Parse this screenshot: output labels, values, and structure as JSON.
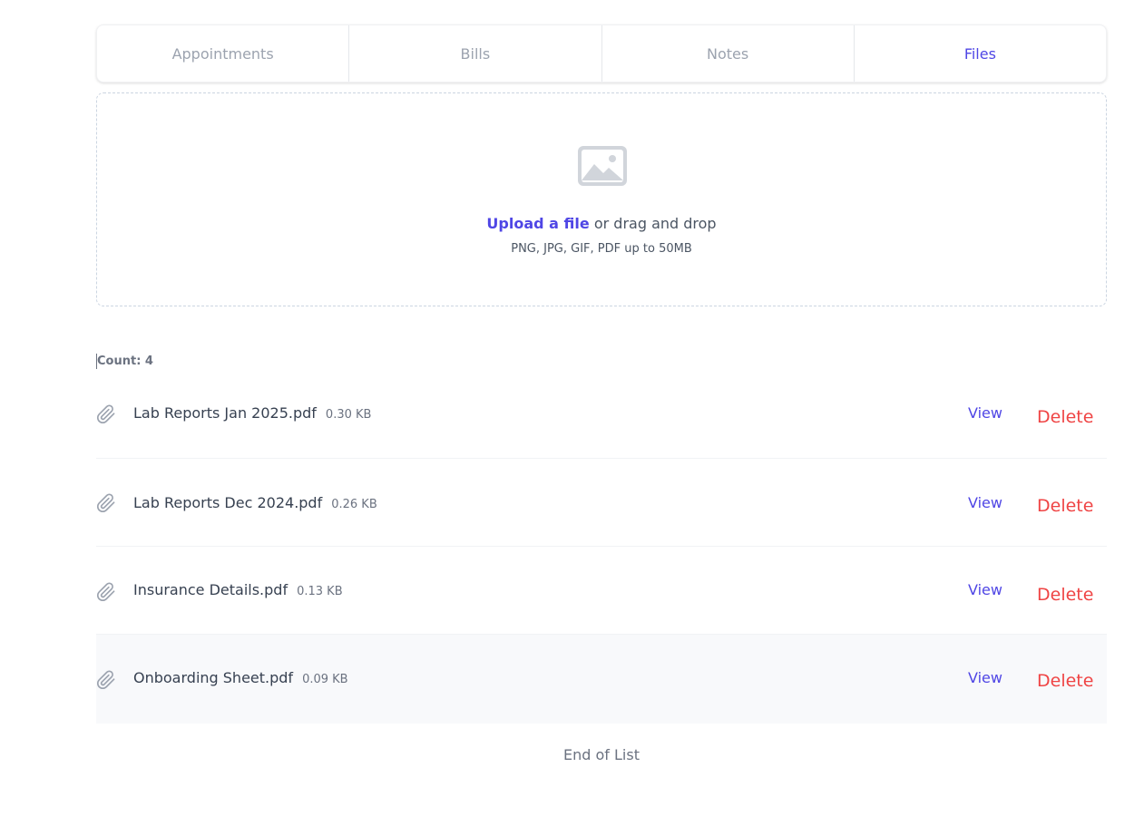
{
  "tabs": [
    {
      "label": "Appointments",
      "active": false
    },
    {
      "label": "Bills",
      "active": false
    },
    {
      "label": "Notes",
      "active": false
    },
    {
      "label": "Files",
      "active": true
    }
  ],
  "dropzone": {
    "icon": "image-icon",
    "upload_link": "Upload a file",
    "drag_text": "or drag and drop",
    "hint": "PNG, JPG, GIF, PDF up to 50MB"
  },
  "count_label": "Count: 4",
  "files": [
    {
      "name": "Lab Reports Jan 2025.pdf",
      "size": "0.30 KB",
      "view": "View",
      "delete": "Delete"
    },
    {
      "name": "Lab Reports Dec 2024.pdf",
      "size": "0.26 KB",
      "view": "View",
      "delete": "Delete"
    },
    {
      "name": "Insurance Details.pdf",
      "size": "0.13 KB",
      "view": "View",
      "delete": "Delete"
    },
    {
      "name": "Onboarding Sheet.pdf",
      "size": "0.09 KB",
      "view": "View",
      "delete": "Delete"
    }
  ],
  "end_text": "End of List",
  "colors": {
    "accent": "#4f46e5",
    "danger": "#ef4444",
    "muted": "#9ca3af"
  }
}
